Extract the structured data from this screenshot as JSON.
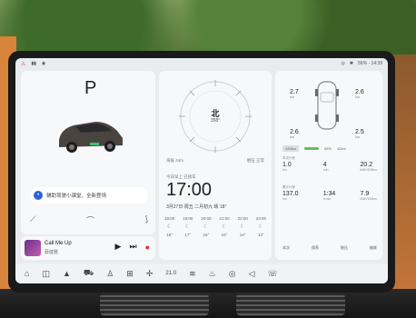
{
  "status": {
    "left_icons": [
      "warning-icon",
      "signal-icon",
      "user-icon"
    ],
    "right_text": "56% · 14:39",
    "time_small": "14:39"
  },
  "left": {
    "gear": "P",
    "assist_text": "辅助驾驶小课堂，全新登场",
    "quick_icons": [
      "mirror-icon",
      "hood-icon",
      "wiper-icon"
    ]
  },
  "music": {
    "title": "Call Me Up",
    "artist": "蔡健雅",
    "controls": [
      "play-icon",
      "next-icon",
      "record-icon"
    ]
  },
  "middle": {
    "direction": "北",
    "degree": "358°",
    "alt_left": "海拔 44m",
    "alt_right": "胎压 正常",
    "date_label": "今日早上 已接车",
    "time": "17:00",
    "date_line": "3月27日  周五  二月初九  晴 18°",
    "forecast": [
      {
        "t": "18:00",
        "v": "18°"
      },
      {
        "t": "19:00",
        "v": "17°"
      },
      {
        "t": "20:00",
        "v": "16°"
      },
      {
        "t": "21:00",
        "v": "15°"
      },
      {
        "t": "22:00",
        "v": "14°"
      },
      {
        "t": "23:00",
        "v": "13°"
      }
    ]
  },
  "right": {
    "tyres": {
      "fl": "2.7",
      "fr": "2.6",
      "rl": "2.6",
      "rr": "2.5",
      "unit": "bar"
    },
    "energy": [
      "120km",
      "56%",
      "42km"
    ],
    "stat_label1": "本次行驶",
    "stats1": [
      {
        "v": "1.0",
        "u": "km"
      },
      {
        "v": "4",
        "u": "min"
      },
      {
        "v": "20.2",
        "u": "kWh/100km"
      }
    ],
    "stat_label2": "累计行驶",
    "stats2": [
      {
        "v": "137.0",
        "u": "km"
      },
      {
        "v": "1:34",
        "u": "h:min"
      },
      {
        "v": "7.9",
        "u": "kWh/100km"
      }
    ],
    "tabs": [
      "本次",
      "保养",
      "胎压",
      "能耗"
    ]
  },
  "dock": {
    "temp": "21.0",
    "icons": [
      "home-icon",
      "camera-icon",
      "nav-icon",
      "car-icon",
      "seat-icon",
      "apps-icon",
      "fan-icon",
      "defrost-icon",
      "seat-heat-icon",
      "steering-heat-icon",
      "volume-icon",
      "phone-icon"
    ]
  }
}
